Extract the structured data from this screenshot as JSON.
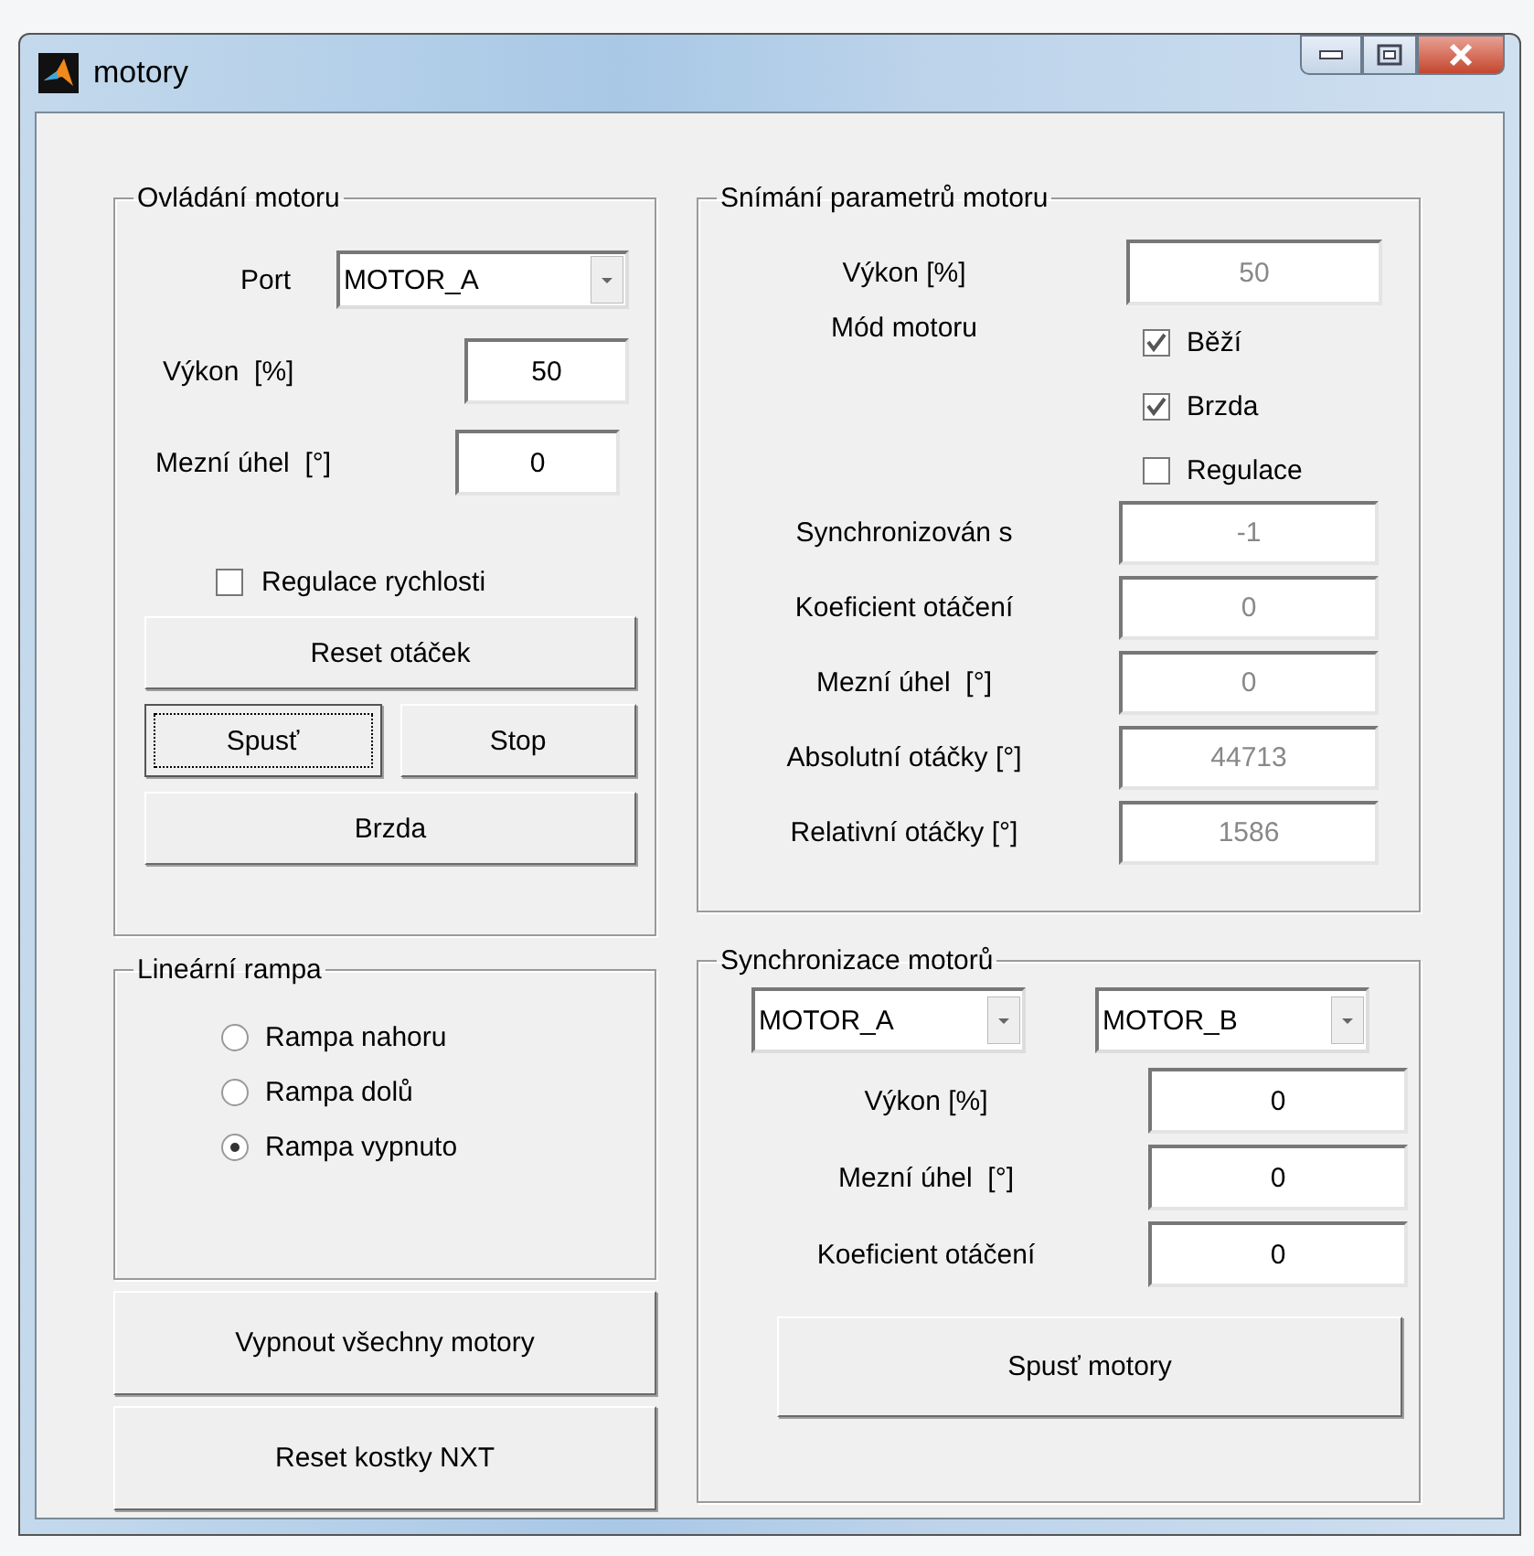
{
  "window": {
    "title": "motory"
  },
  "motor_control": {
    "title": "Ovládání motoru",
    "port": {
      "label": "Port",
      "value": "MOTOR_A"
    },
    "fields": [
      {
        "label": "Výkon  [%]",
        "value": "50"
      },
      {
        "label": "Mezní úhel  [°]",
        "value": "0"
      }
    ],
    "checkbox": {
      "label": "Regulace rychlosti",
      "checked": false
    },
    "button_rows": [
      [
        {
          "label": "Reset otáček",
          "focused": false
        }
      ],
      [
        {
          "label": "Spusť",
          "focused": true
        },
        {
          "label": "Stop",
          "focused": false
        }
      ],
      [
        {
          "label": "Brzda",
          "focused": false
        }
      ]
    ]
  },
  "linear_ramp": {
    "title": "Lineární rampa",
    "options": [
      {
        "label": "Rampa nahoru",
        "selected": false
      },
      {
        "label": "Rampa dolů",
        "selected": false
      },
      {
        "label": "Rampa vypnuto",
        "selected": true
      }
    ]
  },
  "buttons": [
    "Vypnout všechny motory",
    "Reset kostky NXT"
  ],
  "sensing": {
    "title": "Snímání parametrů motoru",
    "power": {
      "label": "Výkon [%]",
      "value": "50",
      "disabled": true
    },
    "mode": {
      "label": "Mód motoru",
      "checkboxes": [
        {
          "label": "Běží",
          "checked": true
        },
        {
          "label": "Brzda",
          "checked": true
        },
        {
          "label": "Regulace",
          "checked": false
        }
      ]
    },
    "fields": [
      {
        "label": "Synchronizován s",
        "value": "-1",
        "disabled": true
      },
      {
        "label": "Koeficient otáčení",
        "value": "0",
        "disabled": true
      },
      {
        "label": "Mezní úhel  [°]",
        "value": "0",
        "disabled": true
      },
      {
        "label": "Absolutní otáčky [°]",
        "value": "44713",
        "disabled": true
      },
      {
        "label": "Relativní otáčky [°]",
        "value": "1586",
        "disabled": true
      }
    ]
  },
  "sync": {
    "title": "Synchronizace motorů",
    "dropdowns": [
      "MOTOR_A",
      "MOTOR_B"
    ],
    "fields": [
      {
        "label": "Výkon [%]",
        "value": "0",
        "disabled": false
      },
      {
        "label": "Mezní úhel  [°]",
        "value": "0",
        "disabled": false
      },
      {
        "label": "Koeficient otáčení",
        "value": "0",
        "disabled": false
      }
    ],
    "button": "Spusť motory"
  }
}
